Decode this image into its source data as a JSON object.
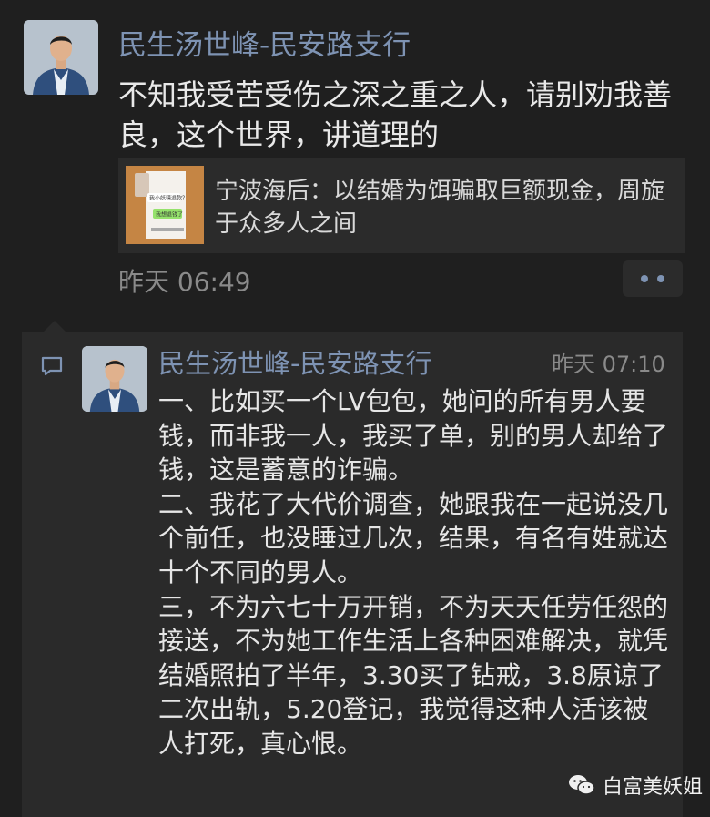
{
  "post": {
    "author": "民生汤世峰-民安路支行",
    "text": "不知我受苦受伤之深之重之人，请别劝我善良，这个世界，讲道理的",
    "link": {
      "title": "宁波海后：以结婚为饵骗取巨额现金，周旋于众多人之间",
      "thumb_bubble_1": "我小妖精退款？",
      "thumb_bubble_2": "我想退钱了"
    },
    "time": "昨天 06:49"
  },
  "comment": {
    "author": "民生汤世峰-民安路支行",
    "time": "昨天 07:10",
    "text": "一、比如买一个LV包包，她问的所有男人要钱，而非我一人，我买了单，别的男人却给了钱，这是蓄意的诈骗。\n二、我花了大代价调查，她跟我在一起说没几个前任，也没睡过几次，结果，有名有姓就达十个不同的男人。\n三，不为六七十万开销，不为天天任劳任怨的接送，不为她工作生活上各种困难解决，就凭结婚照拍了半年，3.30买了钻戒，3.8原谅了二次出轨，5.20登记，我觉得这种人活该被人打死，真心恨。"
  },
  "watermark": {
    "text": "白富美妖姐"
  },
  "colors": {
    "background": "#1f1f1f",
    "name": "#7e93b3",
    "text": "#e9e9e9",
    "panel": "#2a2a2a"
  },
  "icons": {
    "more": "more-dots-icon",
    "comment": "comment-bubble-icon",
    "watermark": "wechat-logo-icon"
  }
}
